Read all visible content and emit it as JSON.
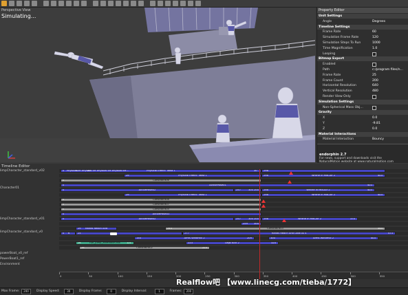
{
  "viewport": {
    "title": "Perspective View",
    "status": "Simulating..."
  },
  "property_editor": {
    "title": "Property Editor",
    "rows": [
      {
        "type": "group",
        "name": "Unit Settings"
      },
      {
        "type": "prop",
        "name": "Angle",
        "value": "Degrees"
      },
      {
        "type": "group",
        "name": "Timeline Settings"
      },
      {
        "type": "prop",
        "name": "Frame Rate",
        "value": "60"
      },
      {
        "type": "prop",
        "name": "Simulation Frame Rate",
        "value": "120"
      },
      {
        "type": "prop",
        "name": "Simulation Steps To Run",
        "value": "1000"
      },
      {
        "type": "prop",
        "name": "Time Magnification",
        "value": "1.0"
      },
      {
        "type": "check",
        "name": "Looping"
      },
      {
        "type": "group",
        "name": "Bitmap Export"
      },
      {
        "type": "check",
        "name": "Enabled"
      },
      {
        "type": "prop",
        "name": "Path",
        "value": "c:/program files/n..."
      },
      {
        "type": "prop",
        "name": "Frame Rate",
        "value": "25"
      },
      {
        "type": "prop",
        "name": "Frame Count",
        "value": "200"
      },
      {
        "type": "prop",
        "name": "Horizontal Resolution",
        "value": "640"
      },
      {
        "type": "prop",
        "name": "Vertical Resolution",
        "value": "480"
      },
      {
        "type": "check",
        "name": "Render View Only"
      },
      {
        "type": "group",
        "name": "Simulation Settings"
      },
      {
        "type": "check",
        "name": "Non-Spherical Mass Obj..."
      },
      {
        "type": "group",
        "name": "Gravity"
      },
      {
        "type": "prop",
        "name": "X",
        "value": "0.0"
      },
      {
        "type": "prop",
        "name": "Y",
        "value": "-9.81"
      },
      {
        "type": "prop",
        "name": "Z",
        "value": "0.0"
      },
      {
        "type": "group",
        "name": "Material Interactions"
      },
      {
        "type": "prop",
        "name": "Material Interaction",
        "value": "Bouncy"
      }
    ],
    "info_title": "endorphin 2.7",
    "info_text_1": "For news, support and downloads visit the",
    "info_text_2": "NaturalMotion website at www.naturalmotion.com"
  },
  "timeline": {
    "title": "Timeline Editor",
    "tracks": [
      "limpCharacter_standard_v02",
      "Character01",
      "limpCharacter_standard_v01",
      "limpCharacter_standard_v0",
      "powerBoat_v0_ref",
      "PowerBoat1_ref",
      "Environment"
    ],
    "clip_rows": [
      [
        {
          "label": "Physical Effect: Twist 1",
          "color": "blue",
          "start": 88,
          "end": 380,
          "nums": [
            "0",
            "10",
            "20",
            "30"
          ],
          "subs": [
            "Physical Eff...",
            "Physical Eff...",
            "Physical Eff...",
            "Physical Eff..."
          ]
        },
        {
          "label": "",
          "color": "blue",
          "start": 380,
          "end": 560,
          "nums": [
            "298"
          ]
        }
      ],
      [
        {
          "label": "Physical Effect: Twist 1",
          "color": "blue",
          "start": 180,
          "end": 380,
          "nums": [
            "29"
          ]
        },
        {
          "label": "Writhe In Mid-Air 2",
          "color": "blue",
          "start": 380,
          "end": 560,
          "nums": [
            "298",
            "403"
          ]
        }
      ],
      [
        {
          "label": "Constraint06",
          "color": "gray",
          "start": 88,
          "end": 380,
          "nums": [
            "0"
          ]
        }
      ],
      [
        {
          "label": "ActivePose01",
          "color": "blue",
          "start": 88,
          "end": 545,
          "nums": [
            "0",
            "403"
          ]
        }
      ],
      [
        {
          "label": "ActivePose02",
          "color": "blue",
          "start": 88,
          "end": 340,
          "nums": [
            "0"
          ]
        },
        {
          "label": "",
          "color": "blue",
          "start": 340,
          "end": 380,
          "nums": [
            "257",
            "300",
            "200"
          ]
        },
        {
          "label": "Writhe In Mid-Air 2",
          "color": "blue",
          "start": 380,
          "end": 545,
          "nums": [
            "298",
            "403"
          ]
        }
      ],
      [
        {
          "label": "Physical Effect: Twist 1",
          "color": "blue",
          "start": 180,
          "end": 380,
          "nums": [
            "29"
          ]
        },
        {
          "label": "Writhe In Mid-Air 2",
          "color": "blue",
          "start": 380,
          "end": 560,
          "nums": [
            "298",
            "403"
          ]
        }
      ],
      [
        {
          "label": "Constraint08",
          "color": "gray",
          "start": 88,
          "end": 380,
          "nums": [
            "0"
          ]
        }
      ],
      [
        {
          "label": "Constraint07",
          "color": "gray",
          "start": 88,
          "end": 380,
          "nums": [
            "0"
          ]
        }
      ],
      [
        {
          "label": "Constraint05",
          "color": "gray",
          "start": 88,
          "end": 380,
          "nums": [
            "0"
          ]
        }
      ],
      [
        {
          "label": "ActivePose03",
          "color": "blue",
          "start": 88,
          "end": 380,
          "nums": [
            "0"
          ]
        }
      ],
      [
        {
          "label": "ActivePose02",
          "color": "blue",
          "start": 88,
          "end": 340,
          "nums": [
            "0"
          ]
        },
        {
          "label": "",
          "color": "blue",
          "start": 340,
          "end": 380,
          "nums": [
            "257",
            "300",
            "200"
          ]
        },
        {
          "label": "Writhe In Mid-Air 2",
          "color": "blue",
          "start": 380,
          "end": 520,
          "nums": [
            "298",
            "370"
          ]
        }
      ],
      [
        {
          "label": "",
          "color": "blue",
          "start": 350,
          "end": 380,
          "nums": [
            "259",
            "300"
          ]
        }
      ],
      [
        {
          "label": "Hands Reach And",
          "color": "blue",
          "start": 110,
          "end": 170,
          "nums": [
            "29"
          ]
        },
        {
          "label": "Constraint03",
          "color": "gray",
          "start": 240,
          "end": 560,
          "nums": [
            "244",
            "464"
          ]
        }
      ],
      [
        {
          "label": "",
          "color": "blue",
          "start": 88,
          "end": 110,
          "nums": [
            "0",
            "6"
          ]
        },
        {
          "label": "",
          "color": "blue",
          "start": 110,
          "end": 265,
          "nums": [
            "25"
          ]
        },
        {
          "label": "Hands Reach And Look At 4",
          "color": "blue",
          "start": 265,
          "end": 575,
          "nums": [
            "277",
            "473"
          ]
        }
      ],
      [
        {
          "label": "Arms Windmill 2",
          "color": "blue",
          "start": 195,
          "end": 370,
          "nums": [
            "150",
            "209"
          ]
        },
        {
          "label": "Arms Windmill 2",
          "color": "blue",
          "start": 390,
          "end": 550,
          "nums": [
            "300",
            "403"
          ]
        }
      ],
      [
        {
          "label": "run_jump_animation.fbx",
          "color": "teal",
          "start": 110,
          "end": 195,
          "nums": [
            "26",
            "121"
          ]
        },
        {
          "label": "Legs Kick 2",
          "color": "blue",
          "start": 270,
          "end": 405,
          "nums": [
            "223",
            "324"
          ]
        }
      ],
      [
        {
          "label": "Constraint02",
          "color": "gray",
          "start": 115,
          "end": 305,
          "nums": [
            "28",
            "223"
          ]
        }
      ]
    ],
    "ruler_labels": [
      "0",
      "50",
      "100",
      "150",
      "200",
      "250",
      "300",
      "350",
      "400",
      "450",
      "500",
      "550"
    ],
    "playhead_frame": "298"
  },
  "statusbar": {
    "items": [
      {
        "label": "Max Frame:",
        "value": "200"
      },
      {
        "label": "Display Speed:",
        "value": "30"
      },
      {
        "label": "Display Frame:",
        "value": "0"
      },
      {
        "label": "Display Interval:",
        "value": "1"
      },
      {
        "label": "Frames:",
        "value": "200"
      }
    ]
  },
  "watermark": "Realflow吧 【www.linecg.com/tieba/1772】",
  "colors": {
    "clip_blue": "#4646c6",
    "clip_gray": "#9a9a9a",
    "clip_teal": "#3fa88a",
    "marker_red": "#e33333",
    "toolbar_accent": "#e0a030"
  }
}
